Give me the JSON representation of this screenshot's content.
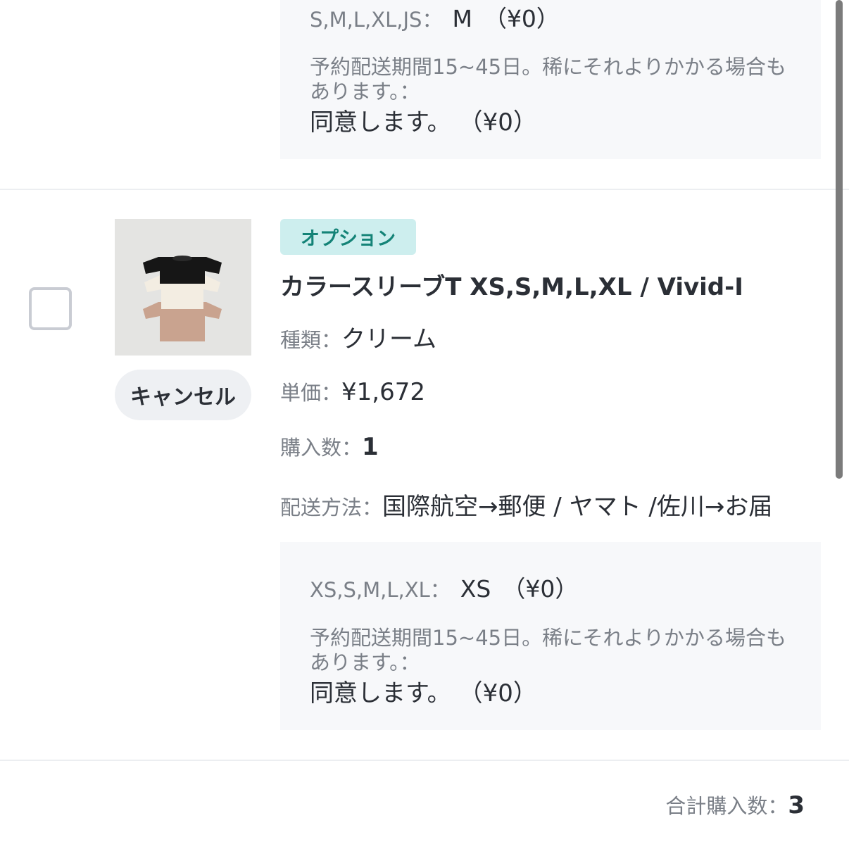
{
  "previous_item": {
    "option_label": "S,M,L,XL,JS：",
    "option_value": "M",
    "option_price": "（¥0）",
    "note": "予約配送期間15~45日。稀にそれよりかかる場合もあります。：",
    "agree_value": "同意します。",
    "agree_price": "（¥0）"
  },
  "item": {
    "badge": "オプション",
    "name": "カラースリーブT XS,S,M,L,XL / Vivid-I",
    "cancel_label": "キャンセル",
    "type_label": "種類：",
    "type_value": "クリーム",
    "price_label": "単価：",
    "price_value": "¥1,672",
    "qty_label": "購入数：",
    "qty_value": "1",
    "shipping_label": "配送方法：",
    "shipping_value": "国際航空→郵便 / ヤマト /佐川→お届",
    "option_label": "XS,S,M,L,XL：",
    "option_value": "XS",
    "option_price": "（¥0）",
    "note": "予約配送期間15~45日。稀にそれよりかかる場合もあります。：",
    "agree_value": "同意します。",
    "agree_price": "（¥0）"
  },
  "summary": {
    "total_label": "合計購入数：",
    "total_value": "3"
  },
  "colors": {
    "badge_bg": "#cdeeee",
    "badge_text": "#148377",
    "option_bg": "#f7f8fa"
  }
}
